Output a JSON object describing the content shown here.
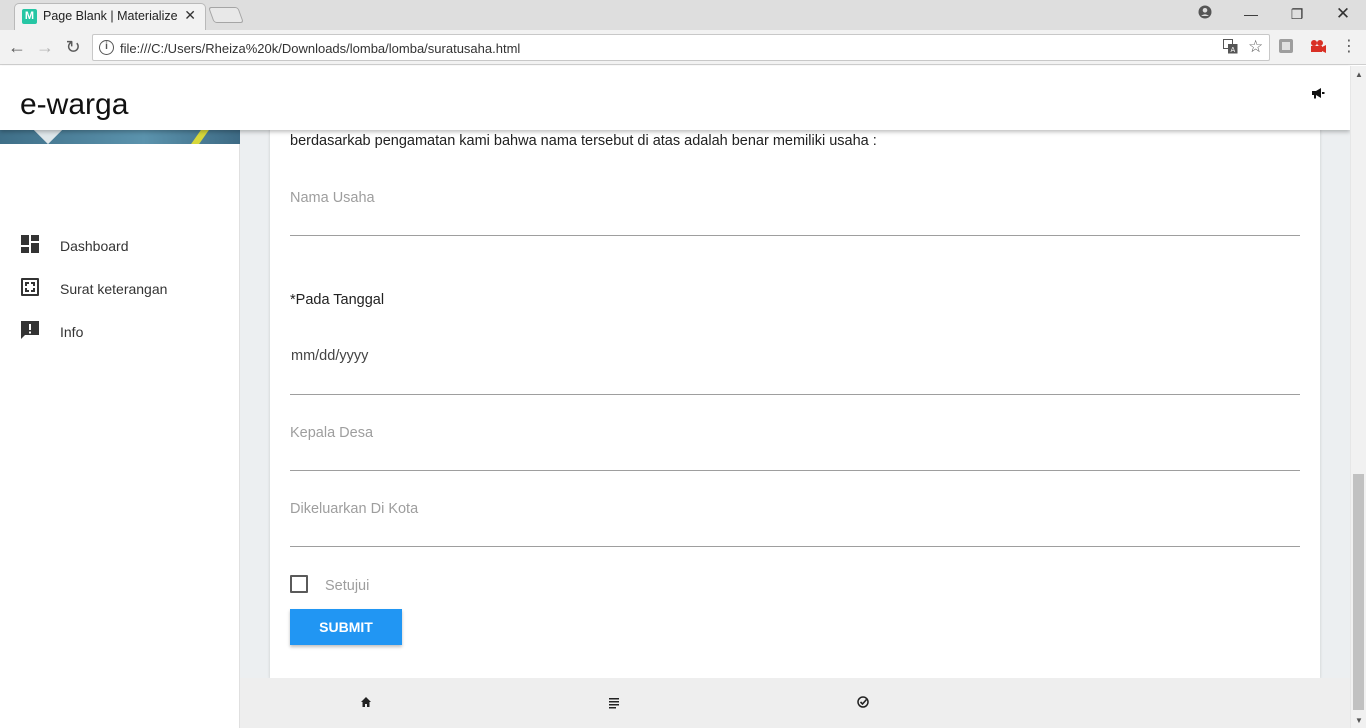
{
  "browser": {
    "tab_title": "Page Blank | Materialize -",
    "favicon_letter": "M",
    "url": "file:///C:/Users/Rheiza%20k/Downloads/lomba/lomba/suratusaha.html"
  },
  "app": {
    "brand": "e-warga"
  },
  "sidebar": {
    "items": [
      {
        "label": "Dashboard",
        "icon": "dashboard-icon"
      },
      {
        "label": "Surat keterangan",
        "icon": "aspect-ratio-icon"
      },
      {
        "label": "Info",
        "icon": "announcement-icon"
      }
    ]
  },
  "form": {
    "intro": "berdasarkab pengamatan kami bahwa nama tersebut di atas adalah benar memiliki usaha :",
    "nama_usaha_placeholder": "Nama Usaha",
    "date_label": "*Pada Tanggal",
    "date_value": "mm/dd/yyyy",
    "kepala_desa_placeholder": "Kepala Desa",
    "kota_placeholder": "Dikeluarkan Di Kota",
    "checkbox_label": "Setujui",
    "submit_label": "SUBMIT"
  },
  "bottom_nav": [
    "home-icon",
    "list-icon",
    "check-circle-icon"
  ],
  "colors": {
    "accent": "#2196f3",
    "favicon": "#26c6a4"
  }
}
